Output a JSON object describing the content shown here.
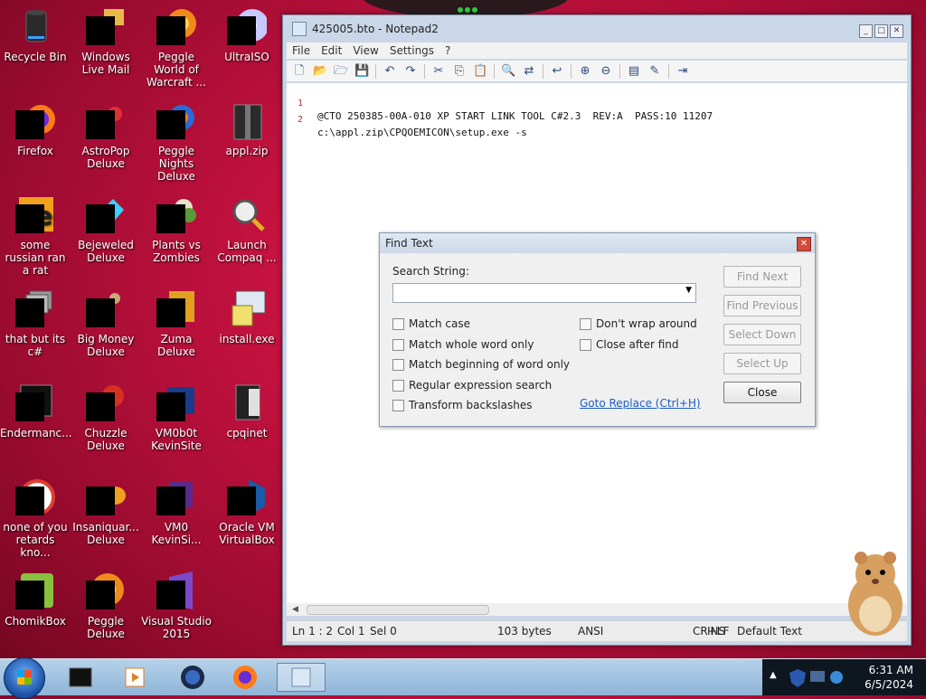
{
  "desktop": {
    "icons": [
      {
        "label": "Recycle Bin"
      },
      {
        "label": "Windows Live Mail"
      },
      {
        "label": "Peggle World of Warcraft ..."
      },
      {
        "label": "UltraISO"
      },
      {
        "label": "Firefox"
      },
      {
        "label": "AstroPop Deluxe"
      },
      {
        "label": "Peggle Nights Deluxe"
      },
      {
        "label": "appl.zip"
      },
      {
        "label": "some russian ran a rat"
      },
      {
        "label": "Bejeweled Deluxe"
      },
      {
        "label": "Plants vs Zombies"
      },
      {
        "label": "Launch Compaq ..."
      },
      {
        "label": "that but its c#"
      },
      {
        "label": "Big Money Deluxe"
      },
      {
        "label": "Zuma Deluxe"
      },
      {
        "label": "install.exe"
      },
      {
        "label": "Endermanc..."
      },
      {
        "label": "Chuzzle Deluxe"
      },
      {
        "label": "VM0b0t KevinSite"
      },
      {
        "label": "cpqinet"
      },
      {
        "label": "none of you retards kno..."
      },
      {
        "label": "Insaniquar... Deluxe"
      },
      {
        "label": "VM0 KevinSi..."
      },
      {
        "label": "Oracle VM VirtualBox"
      },
      {
        "label": "ChomikBox"
      },
      {
        "label": "Peggle Deluxe"
      },
      {
        "label": "Visual Studio 2015"
      }
    ]
  },
  "notepad": {
    "title": "425005.bto - Notepad2",
    "menu": [
      "File",
      "Edit",
      "View",
      "Settings",
      "?"
    ],
    "lines": [
      {
        "num": "1",
        "text": "@CTO 250385-00A-010 XP START LINK TOOL C#2.3  REV:A  PASS:10 11207"
      },
      {
        "num": "2",
        "text": "c:\\appl.zip\\CPQOEMICON\\setup.exe -s"
      }
    ],
    "status": {
      "position": "Ln 1 : 2",
      "col": "Col 1",
      "sel": "Sel 0",
      "size": "103 bytes",
      "encoding": "ANSI",
      "eol": "CR+LF",
      "ins": "INS",
      "scheme": "Default Text"
    }
  },
  "find_dialog": {
    "title": "Find Text",
    "search_label": "Search String:",
    "search_value": "",
    "options": [
      {
        "label": "Match case",
        "checked": false
      },
      {
        "label": "Match whole word only",
        "checked": false
      },
      {
        "label": "Match beginning of word only",
        "checked": false
      },
      {
        "label": "Regular expression search",
        "checked": false
      },
      {
        "label": "Transform backslashes",
        "checked": false
      },
      {
        "label": "Don't wrap around",
        "checked": false
      },
      {
        "label": "Close after find",
        "checked": false
      }
    ],
    "buttons": {
      "find_next": "Find Next",
      "find_previous": "Find Previous",
      "select_down": "Select Down",
      "select_up": "Select Up",
      "close": "Close"
    },
    "goto_replace": "Goto Replace (Ctrl+H)"
  },
  "taskbar": {
    "time": "6:31 AM",
    "date": "6/5/2024"
  },
  "colors": {
    "desktop_bg": "#c4123f",
    "link": "#1c5cc6",
    "line_number": "#c03030"
  }
}
